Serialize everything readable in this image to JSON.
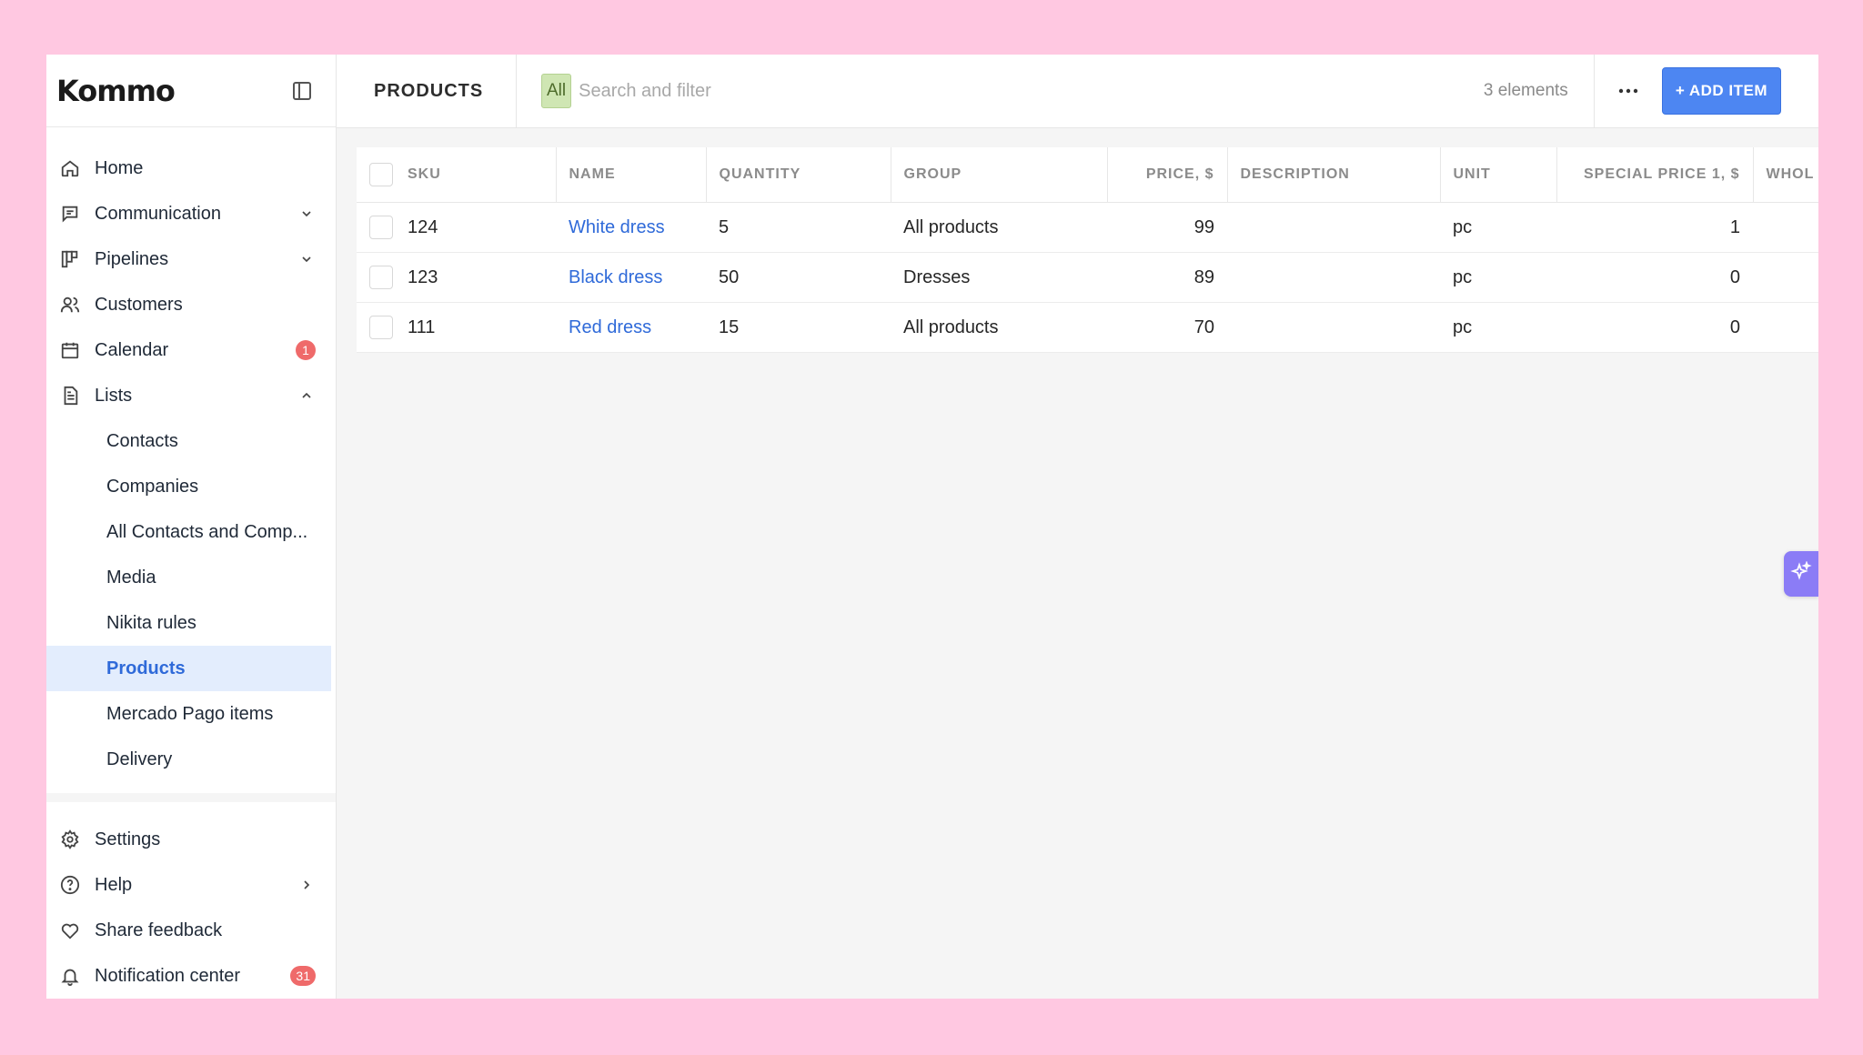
{
  "app": {
    "logo": "Kommo"
  },
  "sidebar": {
    "items": [
      {
        "label": "Home",
        "icon": "home-icon"
      },
      {
        "label": "Communication",
        "icon": "chat-icon"
      },
      {
        "label": "Pipelines",
        "icon": "pipeline-icon"
      },
      {
        "label": "Customers",
        "icon": "users-icon"
      },
      {
        "label": "Calendar",
        "icon": "calendar-icon",
        "badge": "1"
      },
      {
        "label": "Lists",
        "icon": "document-icon"
      }
    ],
    "lists_sub": [
      {
        "label": "Contacts"
      },
      {
        "label": "Companies"
      },
      {
        "label": "All Contacts and Comp..."
      },
      {
        "label": "Media"
      },
      {
        "label": "Nikita rules"
      },
      {
        "label": "Products",
        "active": true
      },
      {
        "label": "Mercado Pago items"
      },
      {
        "label": "Delivery"
      }
    ],
    "bottom": [
      {
        "label": "Settings",
        "icon": "gear-icon"
      },
      {
        "label": "Help",
        "icon": "help-icon"
      },
      {
        "label": "Share feedback",
        "icon": "heart-icon"
      },
      {
        "label": "Notification center",
        "icon": "bell-icon",
        "badge": "31"
      }
    ]
  },
  "header": {
    "title": "PRODUCTS",
    "filter_chip": "All",
    "search_placeholder": "Search and filter",
    "count": "3 elements",
    "add_label": "+ ADD ITEM"
  },
  "table": {
    "columns": [
      "SKU",
      "NAME",
      "QUANTITY",
      "GROUP",
      "PRICE, $",
      "DESCRIPTION",
      "UNIT",
      "SPECIAL PRICE 1, $",
      "WHOL"
    ],
    "rows": [
      {
        "sku": "124",
        "name": "White dress",
        "quantity": "5",
        "group": "All products",
        "price": "99",
        "description": "",
        "unit": "pc",
        "special": "1"
      },
      {
        "sku": "123",
        "name": "Black dress",
        "quantity": "50",
        "group": "Dresses",
        "price": "89",
        "description": "",
        "unit": "pc",
        "special": "0"
      },
      {
        "sku": "111",
        "name": "Red dress",
        "quantity": "15",
        "group": "All products",
        "price": "70",
        "description": "",
        "unit": "pc",
        "special": "0"
      }
    ]
  },
  "colors": {
    "accent": "#4d86f2",
    "link": "#2f6ad9",
    "badge": "#ef6a6a",
    "background": "#ffc8e1"
  }
}
